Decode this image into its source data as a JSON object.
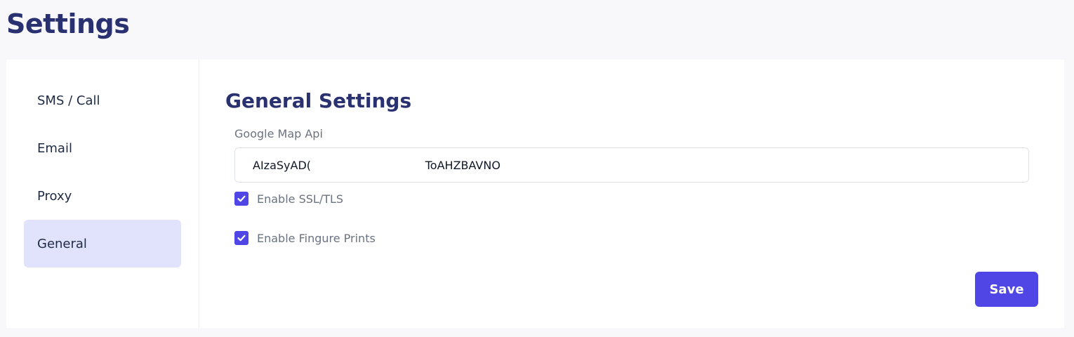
{
  "page": {
    "title": "Settings"
  },
  "sidebar": {
    "items": [
      {
        "label": "SMS / Call",
        "active": false
      },
      {
        "label": "Email",
        "active": false
      },
      {
        "label": "Proxy",
        "active": false
      },
      {
        "label": "General",
        "active": true
      }
    ]
  },
  "general": {
    "title": "General Settings",
    "google_map_api": {
      "label": "Google Map Api",
      "value": "AIzaSyAD(                                ToAHZBAVNO"
    },
    "checkboxes": [
      {
        "label": "Enable SSL/TLS",
        "checked": true
      },
      {
        "label": "Enable Fingure Prints",
        "checked": true
      }
    ],
    "save_label": "Save"
  },
  "colors": {
    "accent": "#4f46e5",
    "active_nav_bg": "#e1e2fb",
    "title": "#2a3170"
  }
}
